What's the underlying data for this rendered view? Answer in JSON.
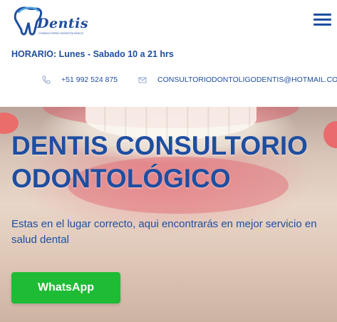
{
  "brand": {
    "logo_word": "Dentis",
    "logo_tagline": "CONSULTORIO ODONTOLÓGICO",
    "primary_color": "#1f4ea0",
    "accent_color": "#1ebc34"
  },
  "header": {
    "menu_icon": "hamburger-menu-icon",
    "hours": "HORARIO: Lunes - Sabado 10 a 21 hrs",
    "phone": {
      "icon": "phone-icon",
      "text": "+51 992 524 875"
    },
    "email": {
      "icon": "envelope-icon",
      "text": "CONSULTORIODONTOLIGODENTIS@HOTMAIL.COM"
    }
  },
  "hero": {
    "title": "DENTIS CONSULTORIO ODONTOLÓGICO",
    "text": "Estas en el lugar correcto, aqui encontrarás en mejor servicio en salud dental",
    "button_label": "WhatsApp"
  }
}
